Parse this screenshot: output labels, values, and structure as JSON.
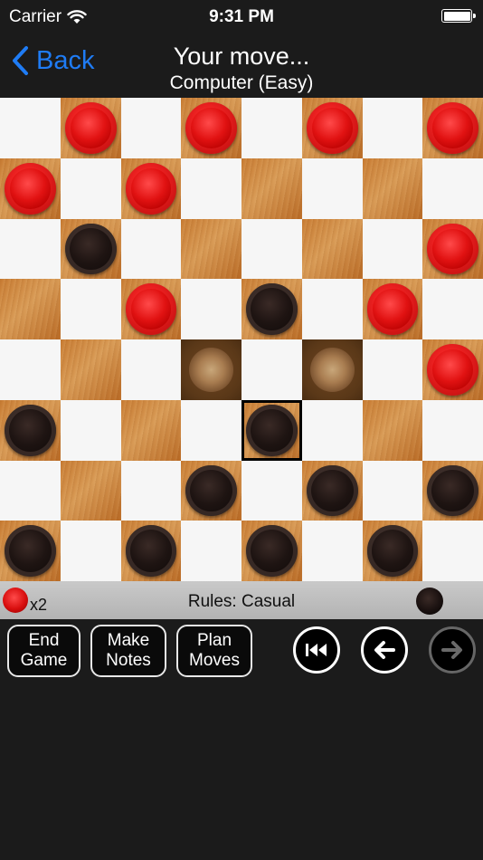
{
  "status_bar": {
    "carrier": "Carrier",
    "time": "9:31 PM"
  },
  "nav": {
    "back_label": "Back",
    "title": "Your move...",
    "subtitle": "Computer (Easy)"
  },
  "board": {
    "rows": [
      [
        "",
        "r",
        "",
        "r",
        "",
        "r",
        "",
        "r"
      ],
      [
        "r",
        "",
        "r",
        "",
        "",
        "",
        "",
        ""
      ],
      [
        "",
        "b",
        "",
        "",
        "",
        "",
        "",
        "r"
      ],
      [
        "",
        "",
        "r",
        "",
        "b",
        "",
        "r",
        ""
      ],
      [
        "",
        "",
        "",
        "h",
        "",
        "h",
        "",
        "r"
      ],
      [
        "b",
        "",
        "",
        "",
        "b",
        "",
        "",
        ""
      ],
      [
        "",
        "",
        "",
        "b",
        "",
        "b",
        "",
        "b"
      ],
      [
        "b",
        "",
        "b",
        "",
        "b",
        "",
        "b",
        ""
      ]
    ],
    "selected": [
      5,
      4
    ],
    "colors": {
      "red": "#d91010",
      "black": "#1a1110",
      "dark_square": "#c98538",
      "light_square": "#f6f6f6"
    }
  },
  "info_bar": {
    "captured_count": "x2",
    "rules": "Rules: Casual"
  },
  "toolbar": {
    "end_game": [
      "End",
      "Game"
    ],
    "make_notes": [
      "Make",
      "Notes"
    ],
    "plan_moves": [
      "Plan",
      "Moves"
    ]
  }
}
